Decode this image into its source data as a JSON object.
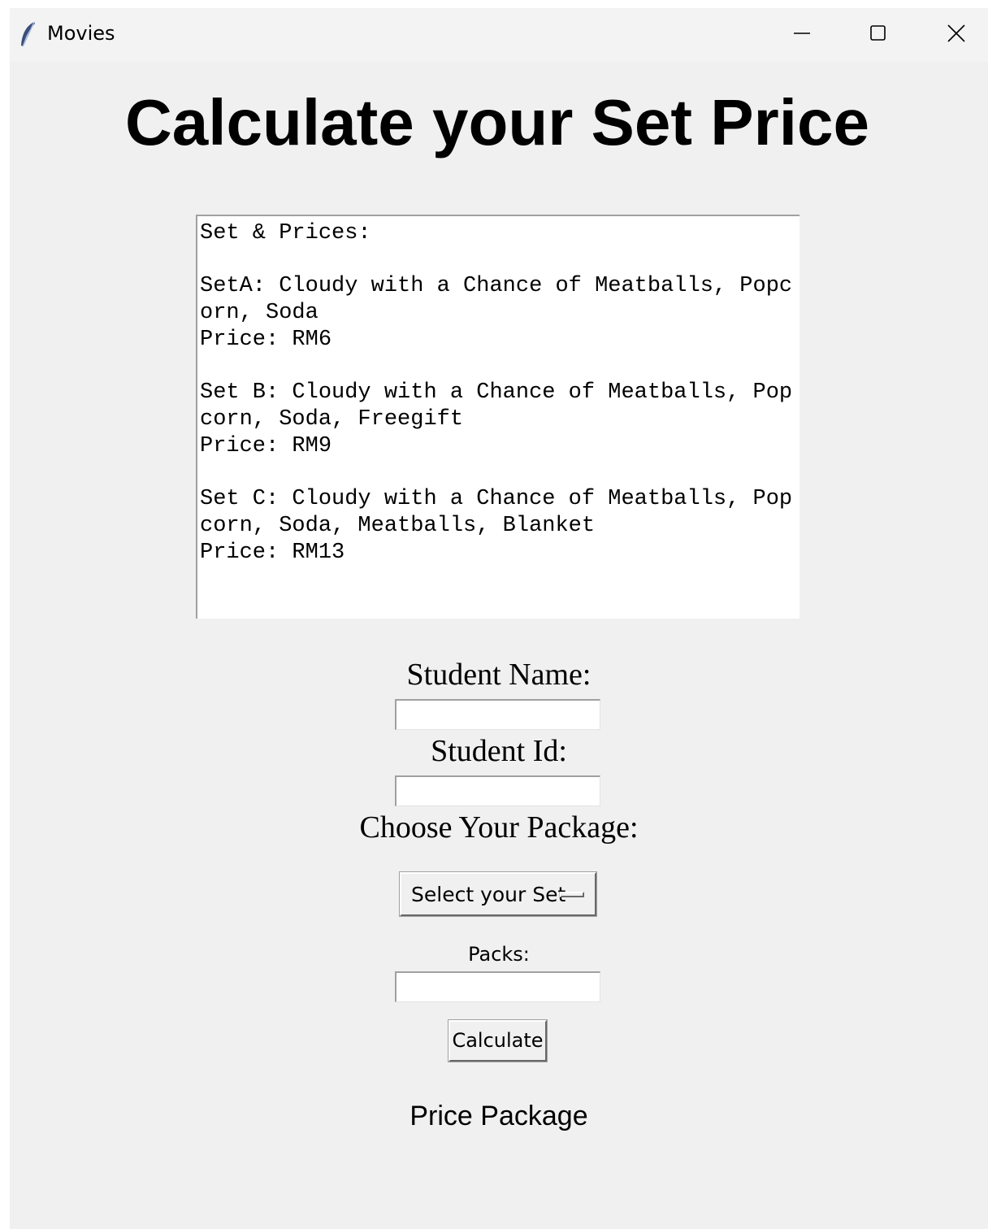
{
  "window": {
    "title": "Movies",
    "app_icon": "feather-icon",
    "controls": {
      "minimize": "minimize-icon",
      "maximize": "maximize-icon",
      "close": "close-icon"
    }
  },
  "main": {
    "heading": "Calculate your Set Price",
    "prices_text": [
      "Set & Prices:",
      "",
      "SetA: Cloudy with a Chance of Meatballs, Popc",
      "orn, Soda",
      "Price: RM6",
      "",
      "Set B: Cloudy with a Chance of Meatballs, Pop",
      "corn, Soda, Freegift",
      "Price: RM9",
      "",
      "Set C: Cloudy with a Chance of Meatballs, Pop",
      "corn, Soda, Meatballs, Blanket",
      "Price: RM13"
    ],
    "student_name_label": "Student Name:",
    "student_name_value": "",
    "student_id_label": "Student Id:",
    "student_id_value": "",
    "package_label": "Choose Your Package:",
    "package_select": "Select your Set",
    "packs_label": "Packs:",
    "packs_value": "",
    "calculate_label": "Calculate",
    "result_label": "Price Package"
  }
}
